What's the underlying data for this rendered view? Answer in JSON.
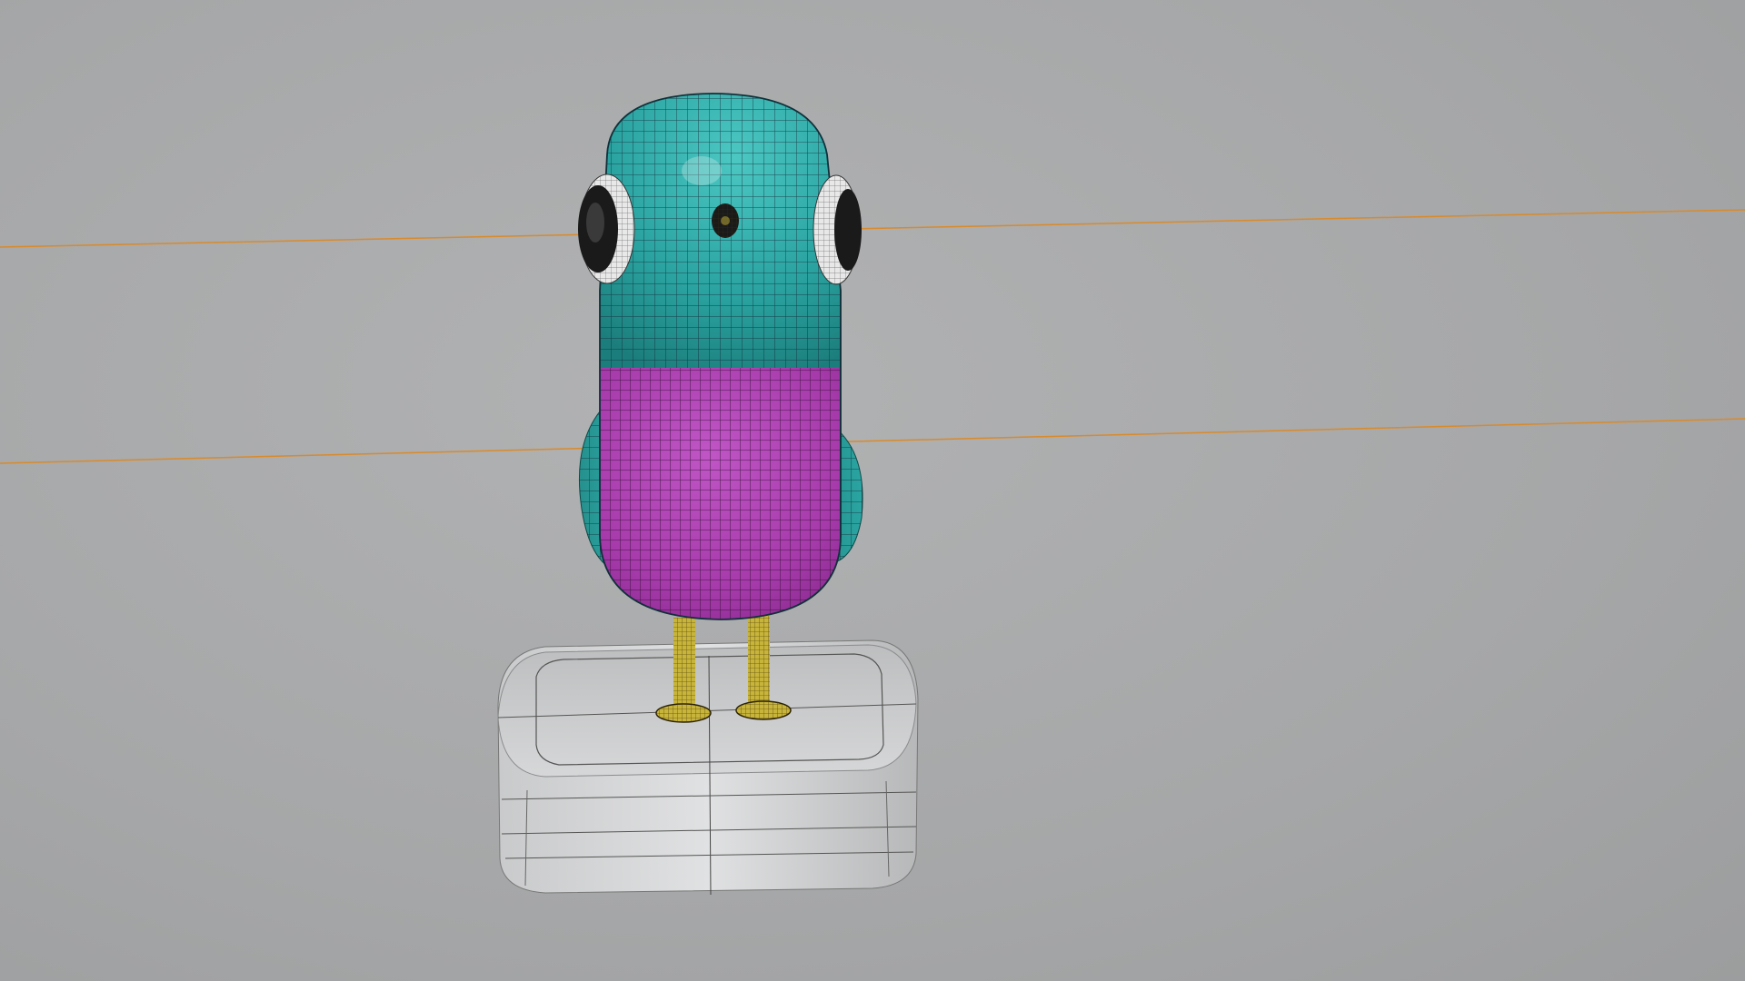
{
  "scene": {
    "subject": "bird-character-model",
    "display_mode": "wireframe-on-shaded",
    "background_color": "#a9aaab",
    "colors": {
      "head": "#2aa6a3",
      "body": "#a63aab",
      "legs": "#c7b43a",
      "base": "#d4d5d6",
      "eye_white": "#e8e8e8",
      "eye_black": "#1a1a1a",
      "guide_line": "#d98a2b"
    }
  }
}
